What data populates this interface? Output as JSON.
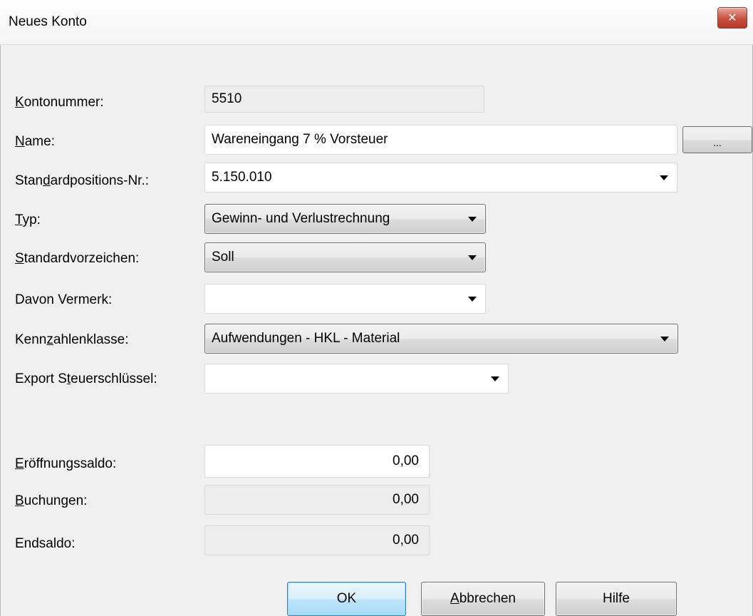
{
  "window": {
    "title": "Neues Konto",
    "close_glyph": "✕"
  },
  "form": {
    "kontonummer": {
      "label_pre": "",
      "label_mn": "K",
      "label_post": "ontonummer:",
      "value": "5510"
    },
    "name": {
      "label_pre": "",
      "label_mn": "N",
      "label_post": "ame:",
      "value": "Wareneingang 7 % Vorsteuer",
      "browse_label": "..."
    },
    "standardposition": {
      "label_pre": "Stan",
      "label_mn": "d",
      "label_post": "ardpositions-Nr.:",
      "value": "5.150.010"
    },
    "typ": {
      "label_pre": "",
      "label_mn": "T",
      "label_post": "yp:",
      "value": "Gewinn- und Verlustrechnung"
    },
    "standardvorzeichen": {
      "label_pre": "",
      "label_mn": "S",
      "label_post": "tandardvorzeichen:",
      "value": "Soll"
    },
    "davon_vermerk": {
      "label": "Davon Vermerk:",
      "value": ""
    },
    "kennzahlenklasse": {
      "label_pre": "Kenn",
      "label_mn": "z",
      "label_post": "ahlenklasse:",
      "value": "Aufwendungen - HKL - Material"
    },
    "export_steuerschluessel": {
      "label_pre": "Export S",
      "label_mn": "t",
      "label_post": "euerschlüssel:",
      "value": ""
    },
    "eroeffnungssaldo": {
      "label_pre": "",
      "label_mn": "E",
      "label_post": "röffnungssaldo:",
      "value": "0,00"
    },
    "buchungen": {
      "label_pre": "",
      "label_mn": "B",
      "label_post": "uchungen:",
      "value": "0,00"
    },
    "endsaldo": {
      "label": "Endsaldo:",
      "value": "0,00"
    }
  },
  "buttons": {
    "ok": "OK",
    "abbrechen": {
      "mn": "A",
      "post": "bbrechen"
    },
    "hilfe": "Hilfe"
  }
}
